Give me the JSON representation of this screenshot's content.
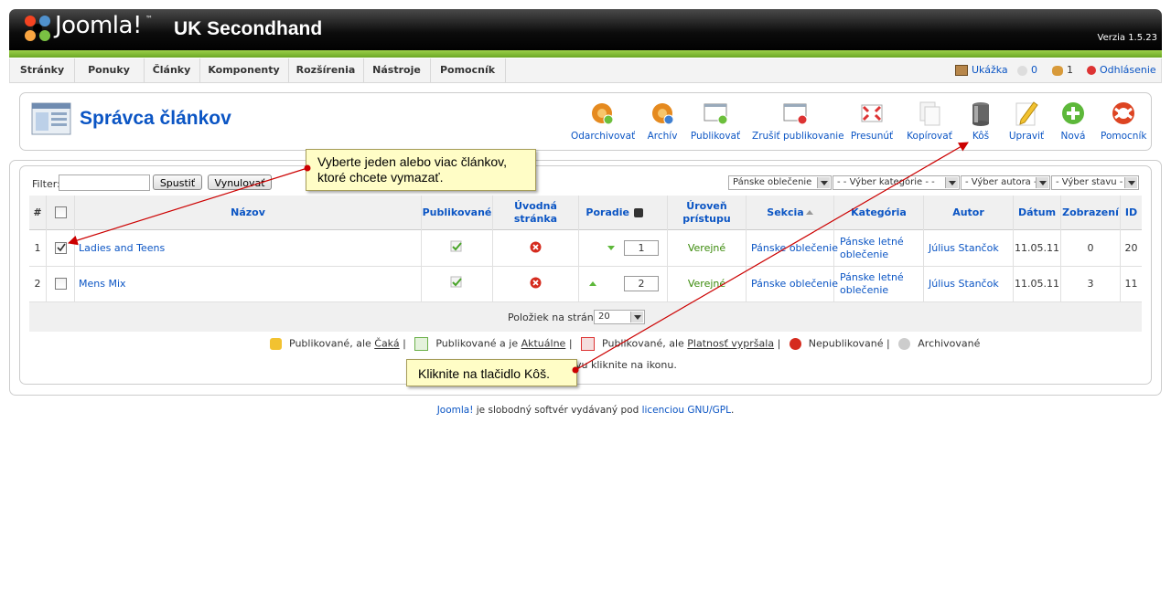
{
  "header": {
    "logo_text": "Joomla!",
    "logo_tm": "™",
    "site_name": "UK Secondhand",
    "version": "Verzia 1.5.23"
  },
  "menu": {
    "items": [
      "Stránky",
      "Ponuky",
      "Články",
      "Komponenty",
      "Rozšírenia",
      "Nástroje",
      "Pomocník"
    ],
    "preview": "Ukážka",
    "messages": "0",
    "users": "1",
    "logout": "Odhlásenie"
  },
  "page": {
    "title": "Správca článkov"
  },
  "toolbar": [
    {
      "label": "Odarchivovať",
      "icon": "unarchive-icon"
    },
    {
      "label": "Archív",
      "icon": "archive-icon"
    },
    {
      "label": "Publikovať",
      "icon": "publish-icon"
    },
    {
      "label": "Zrušiť publikovanie",
      "icon": "unpublish-icon"
    },
    {
      "label": "Presunúť",
      "icon": "move-icon"
    },
    {
      "label": "Kopírovať",
      "icon": "copy-icon"
    },
    {
      "label": "Kôš",
      "icon": "trash-icon"
    },
    {
      "label": "Upraviť",
      "icon": "edit-icon"
    },
    {
      "label": "Nová",
      "icon": "new-icon"
    },
    {
      "label": "Pomocník",
      "icon": "help-icon"
    }
  ],
  "filter": {
    "label": "Filter:",
    "value": "",
    "go_button": "Spustiť",
    "reset_button": "Vynulovať",
    "section_select": "Pánske oblečenie",
    "category_select": "- - Výber kategórie - -",
    "author_select": "- Výber autora -",
    "state_select": "- Výber stavu -"
  },
  "table": {
    "headers": {
      "num": "#",
      "title": "Názov",
      "published": "Publikované",
      "frontpage": "Úvodná stránka",
      "order": "Poradie",
      "access": "Úroveň prístupu",
      "section": "Sekcia",
      "category": "Kategória",
      "author": "Autor",
      "date": "Dátum",
      "hits": "Zobrazení",
      "id": "ID"
    },
    "rows": [
      {
        "num": "1",
        "checked": true,
        "title": "Ladies and Teens",
        "order": "1",
        "access": "Verejné",
        "section": "Pánske oblečenie",
        "category": "Pánske letné oblečenie",
        "author": "Július Stančok",
        "date": "11.05.11",
        "hits": "0",
        "id": "20"
      },
      {
        "num": "2",
        "checked": false,
        "title": "Mens Mix",
        "order": "2",
        "access": "Verejné",
        "section": "Pánske oblečenie",
        "category": "Pánske letné oblečenie",
        "author": "Július Stančok",
        "date": "11.05.11",
        "hits": "3",
        "id": "11"
      }
    ],
    "per_page_label": "Položiek na stránku",
    "per_page_value": "20"
  },
  "legend": {
    "pending": "Publikované, ale ",
    "pending_link": "Čaká",
    "current": "Publikované a je ",
    "current_link": "Aktuálne",
    "expired": "Publikované, ale ",
    "expired_link": "Platnosť vypršala",
    "unpublished": "Nepublikované",
    "archived": "Archivované",
    "sep": "|",
    "hint": "vu kliknite na ikonu."
  },
  "callouts": {
    "select_articles": "Vyberte jeden alebo viac článkov, ktoré chcete vymazať.",
    "click_trash": "Kliknite na tlačidlo Kôš."
  },
  "footer": {
    "joomla_link": "Joomla!",
    "text": " je slobodný softvér vydávaný pod ",
    "license_link": "licenciou GNU/GPL",
    "end": "."
  },
  "colors": {
    "accent": "#0b55c4",
    "header_green": "#7ab63a",
    "published_green": "#3a8a0a",
    "callout_bg": "#fffdc6",
    "arrow_red": "#cc0000"
  }
}
